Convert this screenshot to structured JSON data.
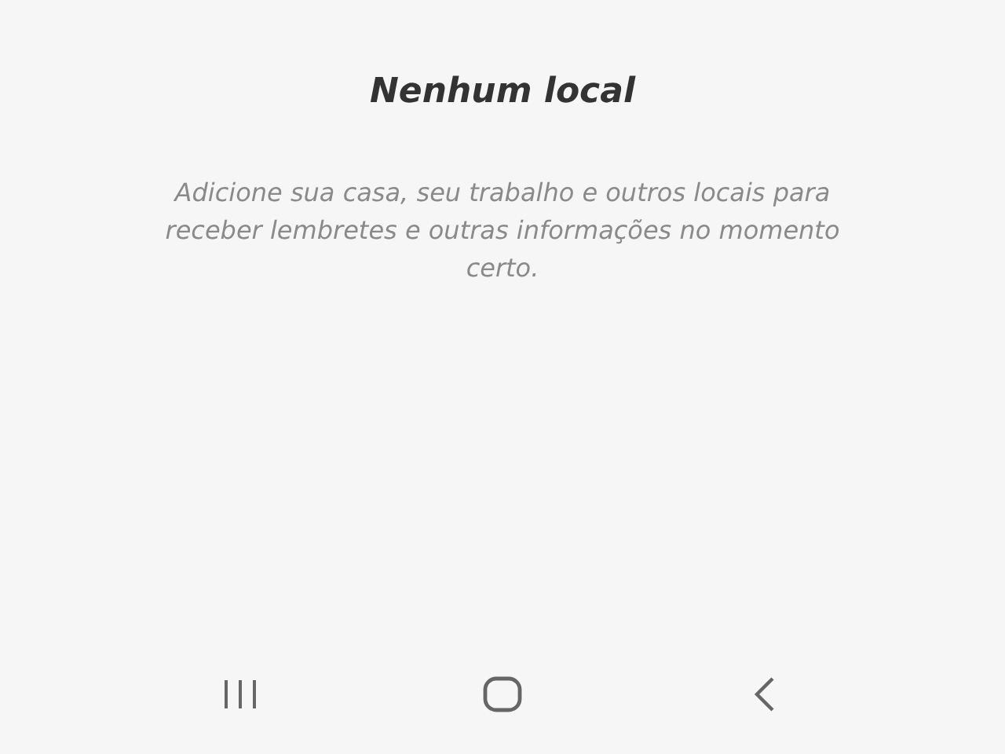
{
  "title": "Nenhum local",
  "message": "Adicione sua casa, seu trabalho e outros locais para receber lembretes e outras informações no momento certo."
}
